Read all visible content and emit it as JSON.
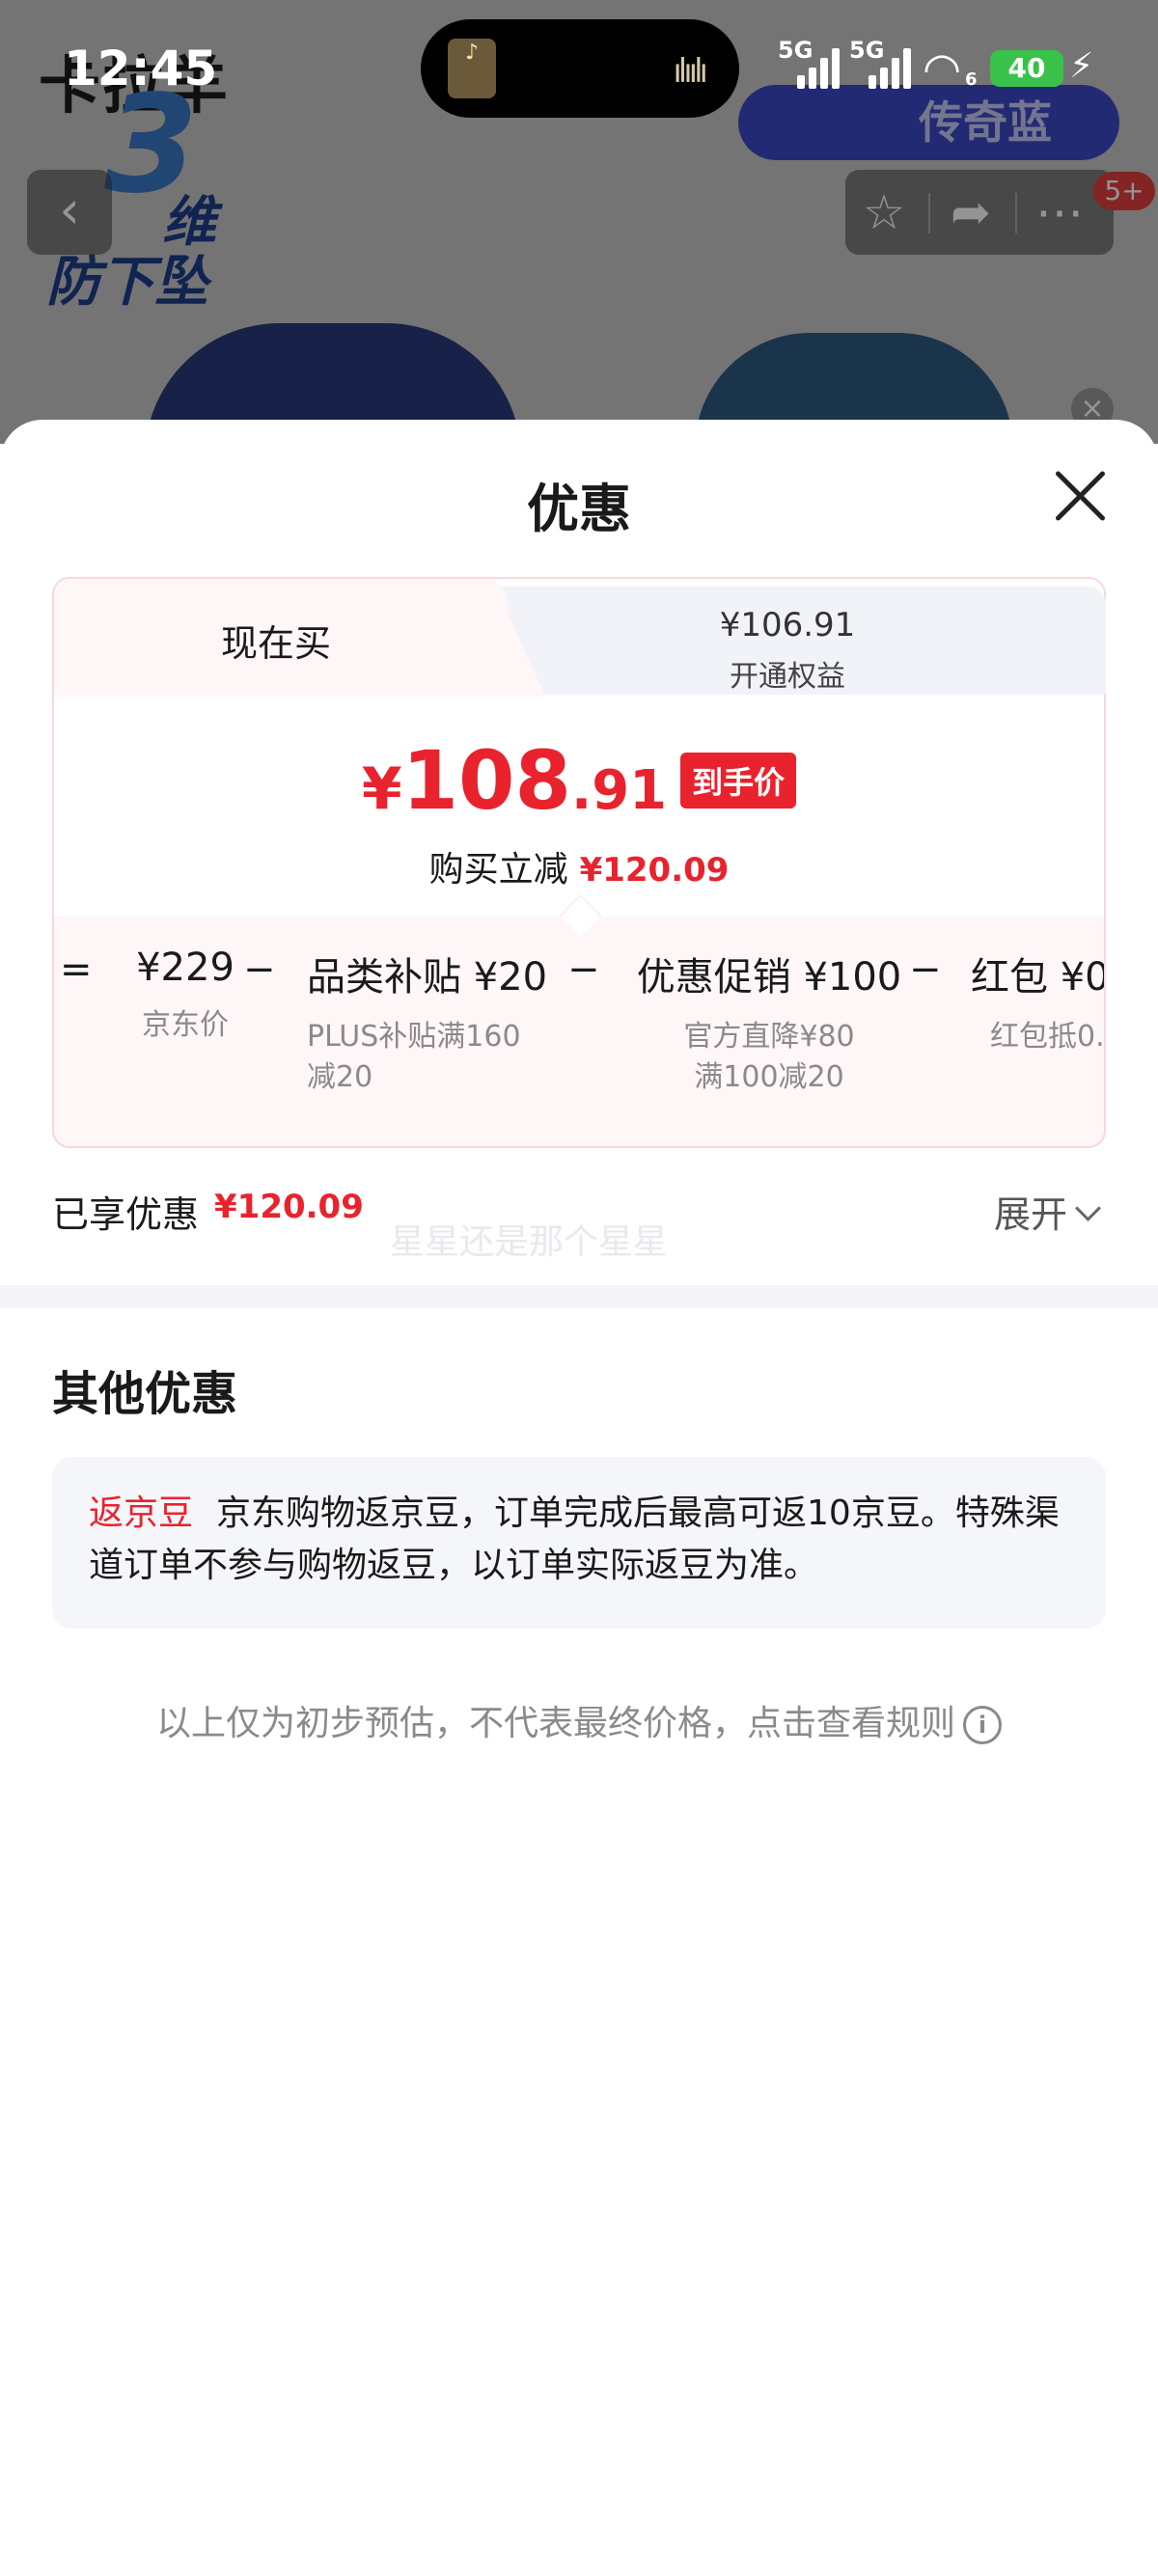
{
  "background": {
    "brand": "卡拉羊",
    "color_tag": "传奇蓝",
    "promo_big": "3",
    "promo_line1": "维",
    "promo_line2": "防下坠",
    "badge": "5+"
  },
  "status_bar": {
    "time": "12:45",
    "signal1": "5G",
    "signal2": "5G",
    "wifi_sub": "6",
    "battery": "40"
  },
  "sheet": {
    "title": "优惠",
    "tabs": {
      "now_label": "现在买",
      "member_price": "¥106.91",
      "member_label": "开通权益"
    },
    "price": {
      "yen": "¥",
      "int": "108",
      "dec": ".91",
      "tag": "到手价",
      "reduce_label": "购买立减",
      "reduce_value": "¥120.09"
    },
    "calc": {
      "eq": "=",
      "minus": "−",
      "items": [
        {
          "value": "¥229",
          "desc1": "京东价",
          "desc2": ""
        },
        {
          "value": "品类补贴 ¥20",
          "desc1": "PLUS补贴满160",
          "desc2": "减20"
        },
        {
          "value": "优惠促销 ¥100",
          "desc1": "官方直降¥80",
          "desc2": "满100减20"
        },
        {
          "value": "红包 ¥0",
          "desc1": "红包抵0.",
          "desc2": ""
        }
      ]
    },
    "enjoyed_label": "已享优惠",
    "enjoyed_value": "¥120.09",
    "watermark": "星星还是那个星星",
    "expand_label": "展开",
    "other_title": "其他优惠",
    "bean": {
      "label": "返京豆",
      "text": "京东购物返京豆，订单完成后最高可返10京豆。特殊渠道订单不参与购物返豆，以订单实际返豆为准。"
    },
    "rule_note": "以上仅为初步预估，不代表最终价格，点击查看规则",
    "info_glyph": "i"
  }
}
